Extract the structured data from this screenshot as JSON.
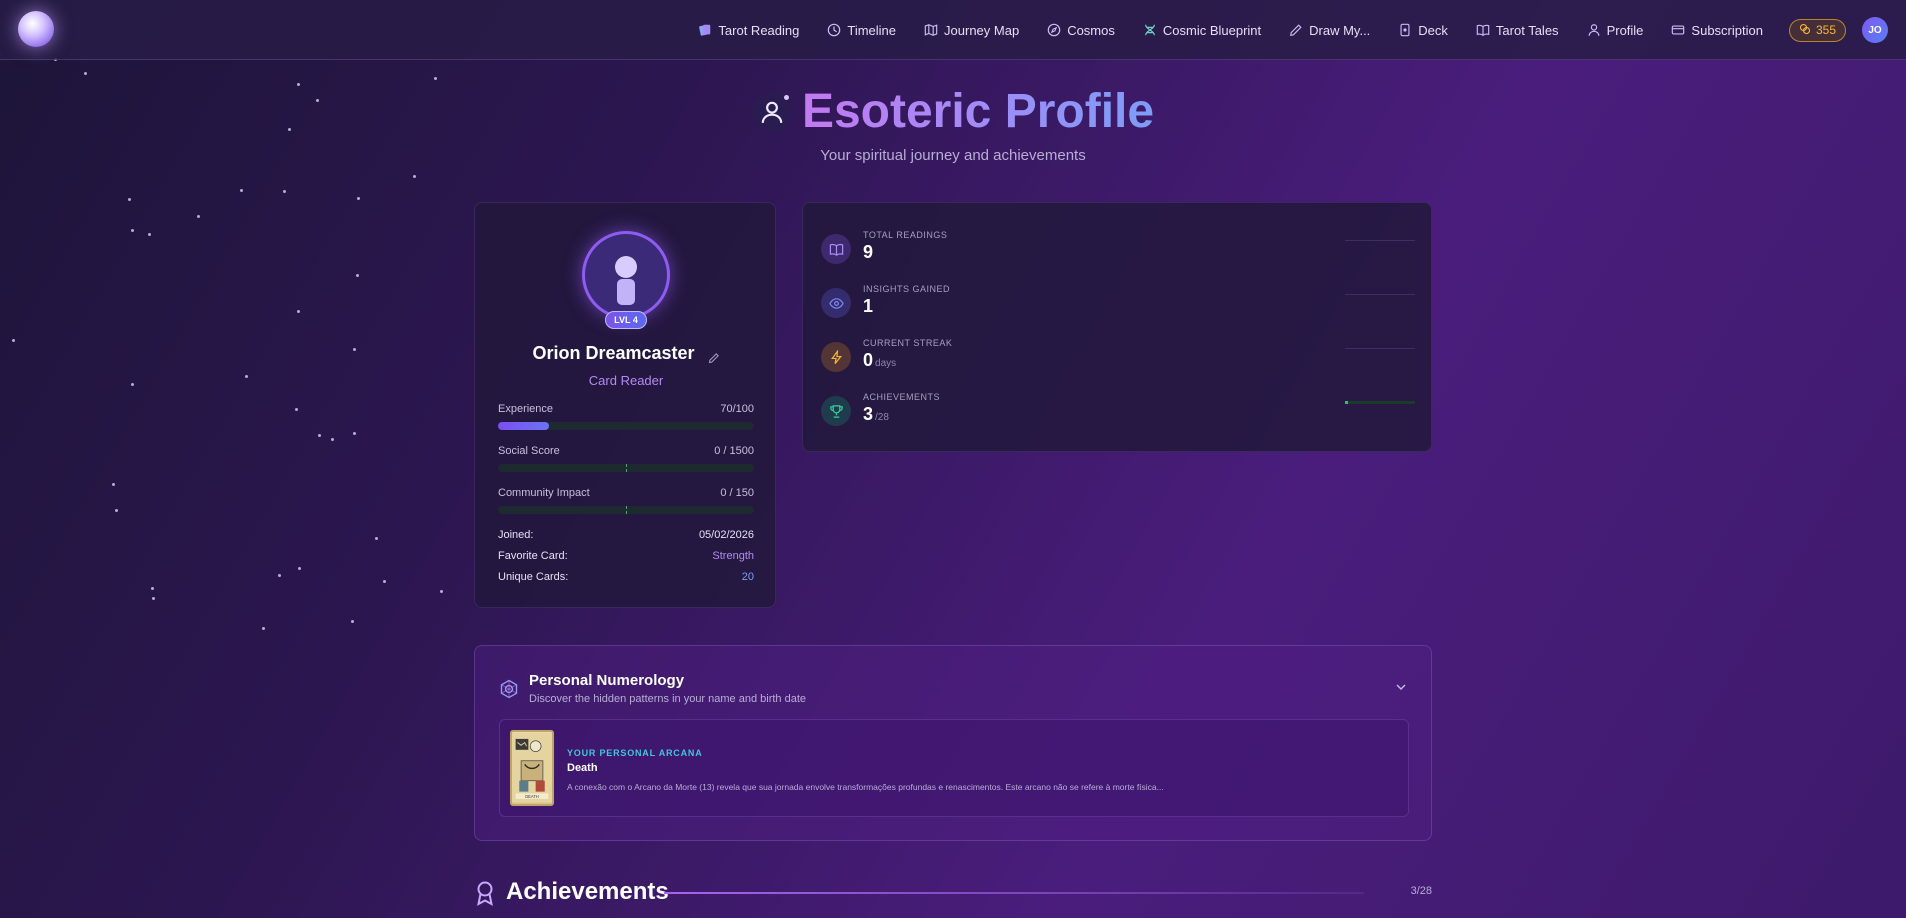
{
  "nav": {
    "items": [
      {
        "label": "Tarot Reading",
        "icon": "tarot-cards-icon"
      },
      {
        "label": "Timeline",
        "icon": "clock-icon"
      },
      {
        "label": "Journey Map",
        "icon": "map-icon"
      },
      {
        "label": "Cosmos",
        "icon": "compass-icon"
      },
      {
        "label": "Cosmic Blueprint",
        "icon": "dna-icon"
      },
      {
        "label": "Draw My...",
        "icon": "pencil-icon"
      },
      {
        "label": "Deck",
        "icon": "deck-icon"
      },
      {
        "label": "Tarot Tales",
        "icon": "book-open-icon"
      },
      {
        "label": "Profile",
        "icon": "user-icon"
      },
      {
        "label": "Subscription",
        "icon": "credit-card-icon"
      }
    ],
    "coins": "355",
    "avatar_initials": "JO"
  },
  "header": {
    "title": "Esoteric Profile",
    "subtitle": "Your spiritual journey and achievements"
  },
  "profile": {
    "level_badge": "LVL 4",
    "name": "Orion Dreamcaster",
    "role": "Card Reader",
    "experience": {
      "label": "Experience",
      "value": "70/100",
      "fraction": 0.2
    },
    "social_score": {
      "label": "Social Score",
      "value": "0 / 1500",
      "fraction": 0
    },
    "community_impact": {
      "label": "Community Impact",
      "value": "0 / 150",
      "fraction": 0
    },
    "joined": {
      "label": "Joined:",
      "value": "05/02/2026"
    },
    "favorite_card": {
      "label": "Favorite Card:",
      "value": "Strength"
    },
    "unique_cards": {
      "label": "Unique Cards:",
      "value": "20"
    }
  },
  "stats": [
    {
      "label": "TOTAL READINGS",
      "value": "9",
      "unit": "",
      "icon": "book-open-icon",
      "color": "#8b5cf6"
    },
    {
      "label": "INSIGHTS GAINED",
      "value": "1",
      "unit": "",
      "icon": "eye-icon",
      "color": "#6366f1"
    },
    {
      "label": "CURRENT STREAK",
      "value": "0",
      "unit": "days",
      "icon": "lightning-icon",
      "color": "#f59e0b"
    },
    {
      "label": "ACHIEVEMENTS",
      "value": "3",
      "unit": "/28",
      "icon": "trophy-icon",
      "color": "#10b981"
    }
  ],
  "numerology": {
    "title": "Personal Numerology",
    "subtitle": "Discover the hidden patterns in your name and birth date",
    "arcana_kicker": "YOUR PERSONAL ARCANA",
    "arcana_name": "Death",
    "arcana_description": "A conexão com o Arcano da Morte (13) revela que sua jornada envolve transformações profundas e renascimentos. Este arcano não se refere à morte física...",
    "card_caption": "DEATH"
  },
  "achievements": {
    "title": "Achievements",
    "count": "3/28"
  }
}
